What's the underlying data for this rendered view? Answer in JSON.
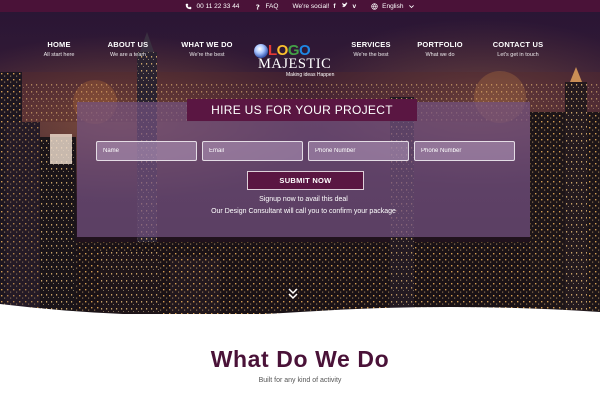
{
  "topbar": {
    "phone": "00 11 22 33 44",
    "faq": "FAQ",
    "social_text": "We're social!",
    "social_icons": [
      "facebook-icon",
      "twitter-icon",
      "vimeo-icon"
    ],
    "language": "English",
    "bg_color": "#4a1238"
  },
  "nav": {
    "items": [
      {
        "title": "HOME",
        "sub": "All start here"
      },
      {
        "title": "ABOUT US",
        "sub": "We are a team"
      },
      {
        "title": "WHAT WE DO",
        "sub": "We're the best"
      },
      {
        "title": "SERVICES",
        "sub": "We're the best"
      },
      {
        "title": "PORTFOLIO",
        "sub": "What we do"
      },
      {
        "title": "CONTACT US",
        "sub": "Let's get in touch"
      }
    ]
  },
  "logo": {
    "brand_letters": [
      "L",
      "O",
      "G",
      "O"
    ],
    "name": "MAJESTIC",
    "tagline": "Making ideas Happen"
  },
  "form": {
    "title": "HIRE US FOR YOUR PROJECT",
    "fields": [
      {
        "placeholder": "Name"
      },
      {
        "placeholder": "Email"
      },
      {
        "placeholder": "Phone Number"
      },
      {
        "placeholder": "Phone Number"
      }
    ],
    "submit_label": "SUBMIT NOW",
    "line1": "Signup now to avail this deal",
    "line2": "Our Design Consultant will call you to confirm your package",
    "accent": "#5a1642"
  },
  "section": {
    "title": "What Do We Do",
    "subtitle": "Built for any kind of activity",
    "title_color": "#4a1238"
  }
}
